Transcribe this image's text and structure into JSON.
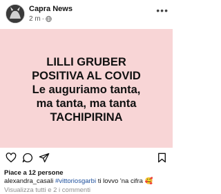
{
  "header": {
    "page_name": "Capra News",
    "time": "2 m",
    "separator": "·",
    "more": "•••"
  },
  "post": {
    "lines": [
      "LILLI GRUBER",
      "POSITIVA AL COVID",
      "Le auguriamo tanta,",
      "ma tanta, ma tanta",
      "TACHIPIRINA"
    ],
    "background": "#f8d5d6"
  },
  "footer": {
    "likes": "Piace a 12 persone",
    "comment_user": "alexandra_casali",
    "comment_mention": "#vittoriosgarbi",
    "comment_text": "ti lovvo 'na cifra 🥰",
    "view_all": "Visualizza tutti e 2 i commenti"
  },
  "icons": [
    "like-icon",
    "comment-icon",
    "send-icon",
    "bookmark-icon",
    "globe-icon",
    "more-icon"
  ]
}
